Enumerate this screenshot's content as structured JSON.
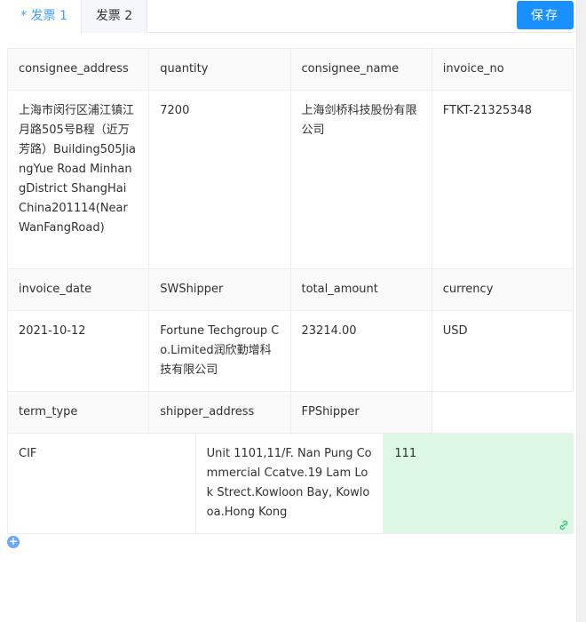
{
  "tabs": [
    {
      "label": "* 发票 1"
    },
    {
      "label": "发票 2"
    }
  ],
  "toolbar": {
    "save_label": "保存"
  },
  "grid": {
    "header1": [
      "consignee_address",
      "quantity",
      "consignee_name",
      "invoice_no"
    ],
    "data1": [
      "上海市闵行区浦江镇江月路505号B程（近万芳路）Building505JiangYue Road MinhangDistrict ShangHai China201114(NearWanFangRoad)",
      "7200",
      "上海剑桥科技股份有限公司",
      "FTKT-21325348"
    ],
    "header2": [
      "invoice_date",
      "SWShipper",
      "total_amount",
      "currency"
    ],
    "data2": [
      "2021-10-12",
      "Fortune Techgroup Co.Limited润欣勤增科技有限公司",
      "23214.00",
      "USD"
    ],
    "header3": [
      "term_type",
      "shipper_address",
      "FPShipper"
    ],
    "data3": [
      "CIF",
      "Unit 1101,11/F. Nan Pung Commercial Ccatve.19 Lam Lok Strect.Kowloon Bay, Kowlooa.Hong Kong",
      "111"
    ]
  },
  "colors": {
    "accent": "#409eff",
    "button": "#1890ff",
    "highlight": "#dcf8e4",
    "link_icon": "#3cc48a"
  },
  "icons": {
    "link": "link-icon",
    "add": "plus-circle-icon"
  }
}
